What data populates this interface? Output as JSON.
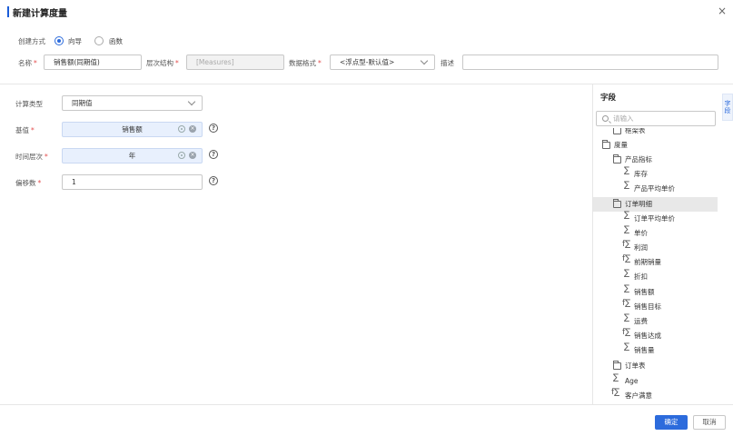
{
  "dialog": {
    "title": "新建计算度量",
    "close_glyph": "×"
  },
  "form": {
    "create_mode_label": "创建方式",
    "create_mode_options": [
      "向导",
      "函数"
    ],
    "create_mode_selected": "向导",
    "name_label": "名称",
    "name_value": "销售额(同期值)",
    "hierarchy_label": "层次结构",
    "hierarchy_value": "[Measures]",
    "format_label": "数据格式",
    "format_value": "<浮点型-默认值>",
    "desc_label": "描述",
    "desc_value": ""
  },
  "calc": {
    "type_label": "计算类型",
    "type_value": "同期值",
    "base_label": "基值",
    "base_value": "销售额",
    "time_label": "时间层次",
    "time_value": "年",
    "offset_label": "偏移数",
    "offset_value": "1",
    "help_glyph": "?"
  },
  "fields_panel": {
    "title": "字段",
    "search_placeholder": "请输入",
    "side_tab": "字段",
    "items": [
      {
        "label": "框架表",
        "icon": "folder-icon"
      },
      {
        "label": "度量",
        "icon": "folder-icon"
      },
      {
        "label": "产品指标",
        "icon": "folder-icon"
      },
      {
        "label": "库存",
        "icon": "sigma-icon"
      },
      {
        "label": "产品平均单价",
        "icon": "sigma-icon"
      },
      {
        "label": "订单明细",
        "icon": "folder-icon",
        "selected": true
      },
      {
        "label": "订单平均单价",
        "icon": "sigma-icon"
      },
      {
        "label": "单价",
        "icon": "sigma-icon"
      },
      {
        "label": "利润",
        "icon": "calc-measure-icon"
      },
      {
        "label": "前期销量",
        "icon": "calc-measure-icon"
      },
      {
        "label": "折扣",
        "icon": "sigma-icon"
      },
      {
        "label": "销售额",
        "icon": "sigma-icon"
      },
      {
        "label": "销售目标",
        "icon": "calc-measure-icon"
      },
      {
        "label": "运费",
        "icon": "sigma-icon"
      },
      {
        "label": "销售达成",
        "icon": "calc-measure-icon"
      },
      {
        "label": "销售量",
        "icon": "sigma-icon"
      },
      {
        "label": "订单表",
        "icon": "folder-icon"
      },
      {
        "label": "Age",
        "icon": "sigma-icon"
      },
      {
        "label": "客户满意",
        "icon": "calc-measure-icon"
      }
    ]
  },
  "footer": {
    "ok_label": "确定",
    "cancel_label": "取消"
  },
  "colors": {
    "accent": "#2c6bdc",
    "required": "#e34d4d",
    "chip": "#e8f0fd"
  }
}
